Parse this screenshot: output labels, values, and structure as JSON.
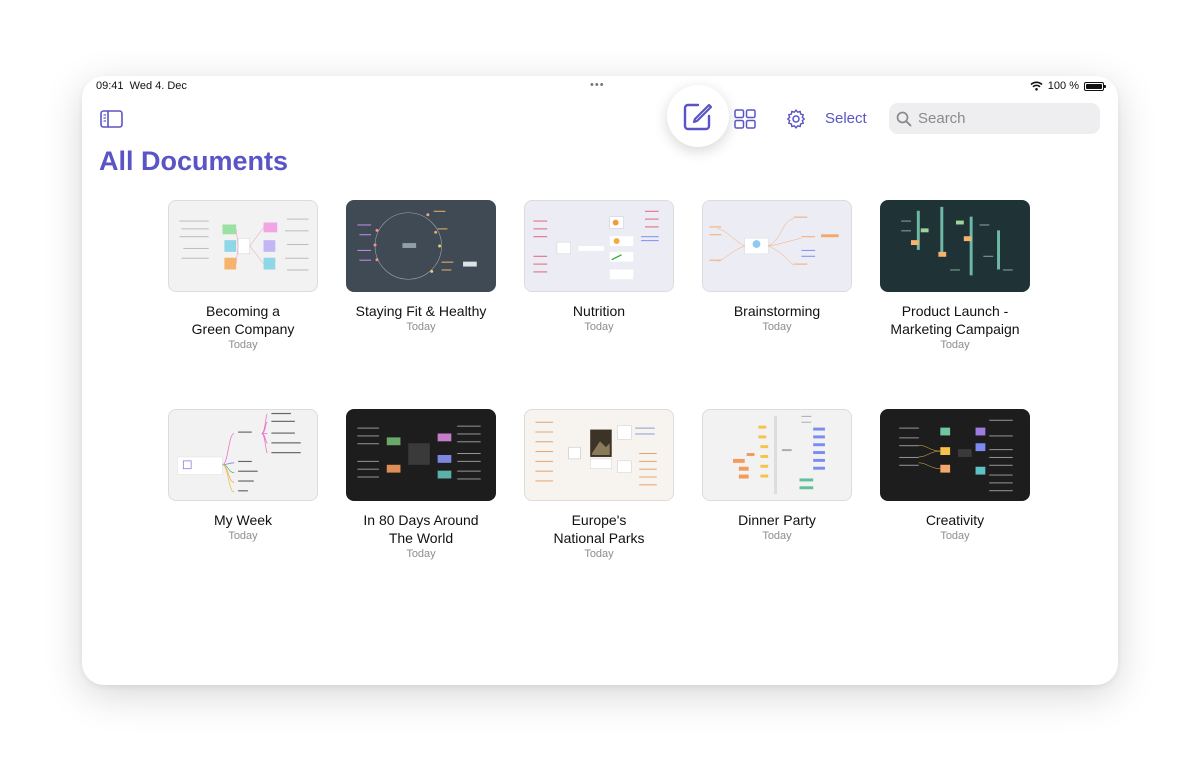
{
  "status_bar": {
    "time": "09:41",
    "date": "Wed 4. Dec",
    "battery": "100 %"
  },
  "toolbar": {
    "select_label": "Select"
  },
  "search": {
    "placeholder": "Search"
  },
  "page_title": "All Documents",
  "documents": [
    {
      "title_line1": "Becoming a",
      "title_line2": "Green Company",
      "date": "Today",
      "theme": "light"
    },
    {
      "title_line1": "Staying Fit & Healthy",
      "title_line2": "",
      "date": "Today",
      "theme": "slate"
    },
    {
      "title_line1": "Nutrition",
      "title_line2": "",
      "date": "Today",
      "theme": "lavender"
    },
    {
      "title_line1": "Brainstorming",
      "title_line2": "",
      "date": "Today",
      "theme": "lavender"
    },
    {
      "title_line1": "Product Launch -",
      "title_line2": "Marketing Campaign",
      "date": "Today",
      "theme": "teal-dark"
    },
    {
      "title_line1": "My Week",
      "title_line2": "",
      "date": "Today",
      "theme": "light"
    },
    {
      "title_line1": "In 80 Days Around",
      "title_line2": "The World",
      "date": "Today",
      "theme": "dark"
    },
    {
      "title_line1": "Europe's",
      "title_line2": "National Parks",
      "date": "Today",
      "theme": "cream"
    },
    {
      "title_line1": "Dinner Party",
      "title_line2": "",
      "date": "Today",
      "theme": "light"
    },
    {
      "title_line1": "Creativity",
      "title_line2": "",
      "date": "Today",
      "theme": "dark"
    }
  ],
  "colors": {
    "accent": "#5a54c6",
    "arrow": "#f0566e"
  },
  "icons": [
    "sidebar-icon",
    "compose-icon",
    "grid-icon",
    "gear-icon",
    "search-icon",
    "wifi-icon",
    "battery-icon"
  ]
}
